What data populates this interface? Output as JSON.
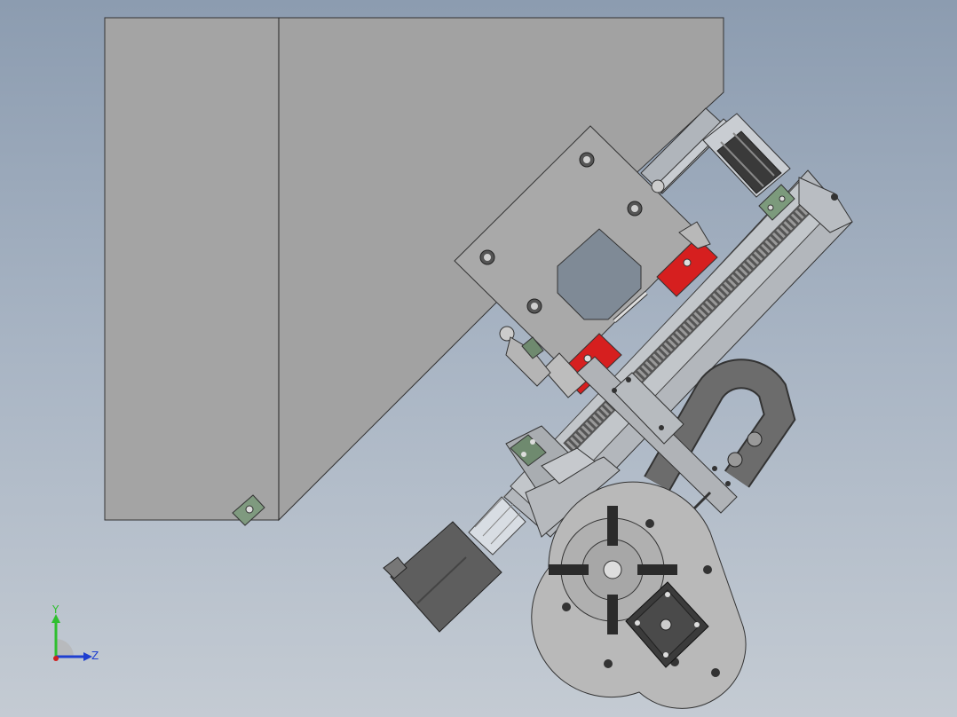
{
  "viewport": {
    "background_top": "#8c9cb0",
    "background_bottom": "#c4cbd3"
  },
  "model": {
    "housing_color": "#a4a4a4",
    "slider_block_color": "#b8b8b8",
    "accent_block_color": "#d61f1f",
    "window_color": "#7f8a96",
    "motor_color": "#5e5e5e",
    "coupling_color": "#d8dde3",
    "ballscrew_color": "#8a8a8a",
    "turntable_color": "#b9b9b9",
    "chuck_jaw_color": "#2b2b2b",
    "cable_chain_color": "#6c6c6c"
  },
  "triad": {
    "y_label": "Y",
    "z_label": "Z",
    "y_color": "#2fbf2f",
    "z_color": "#1f3fd0",
    "x_color": "#d02020"
  }
}
